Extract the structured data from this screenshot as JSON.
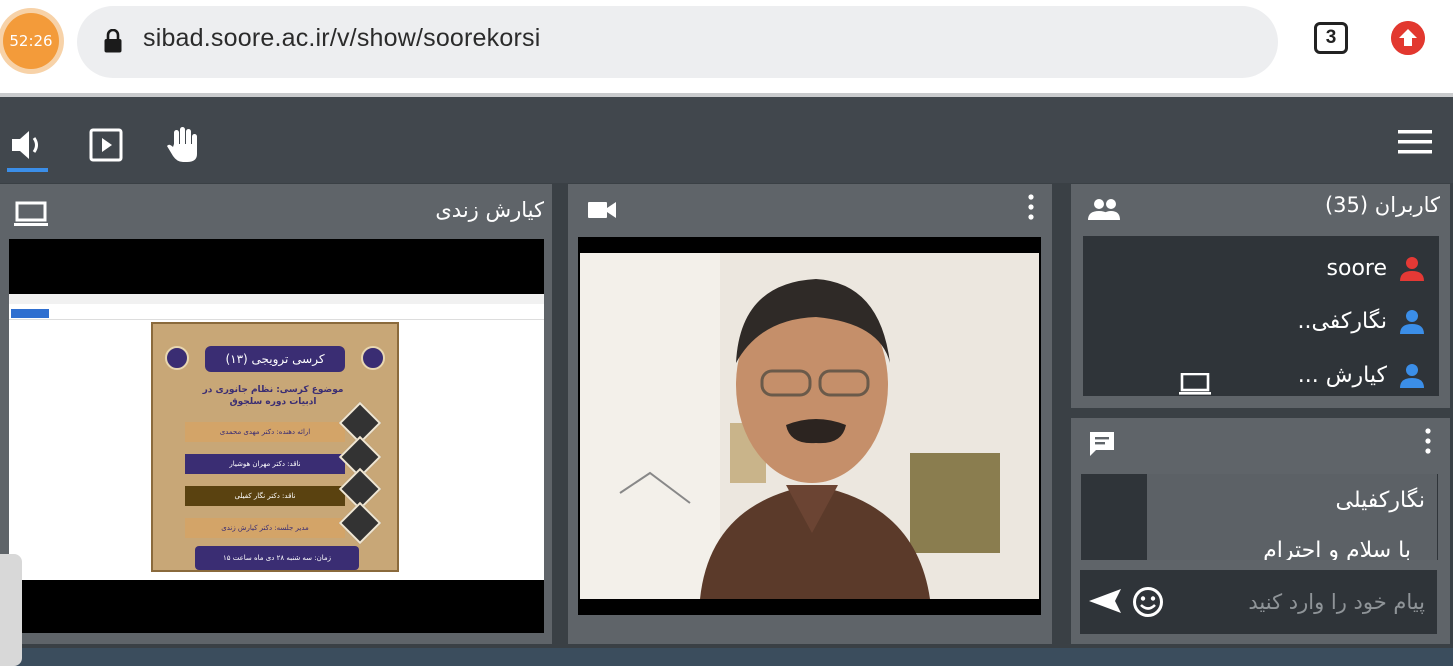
{
  "browser": {
    "timer": "52:26",
    "url": "sibad.soore.ac.ir/v/show/soorekorsi",
    "tab_count": "3"
  },
  "toolbar": {
    "icons": [
      "speaker-icon",
      "play-icon",
      "raise-hand-icon",
      "menu-icon"
    ],
    "accent": "#3b8ee8"
  },
  "presentation": {
    "title": "کیارش زندی",
    "poster": {
      "title": "کرسی ترویجی (۱۳)",
      "subject": "موضوع کرسی: نظام جانوری در ادبیات دوره سلجوق",
      "rows": [
        "ارائه دهنده: دکتر مهدی محمدی",
        "ناقد: دکتر مهران هوشیار",
        "ناقد: دکتر نگار کفیلی",
        "مدیر جلسه: دکتر کیارش زندی"
      ],
      "footer": "زمان: سه شنبه ۲۸ دی ماه ساعت ۱۵"
    }
  },
  "video": {
    "icon": "videocam-icon"
  },
  "users": {
    "title": "کاربران (35)",
    "items": [
      {
        "name": "soore",
        "color": "#e53935"
      },
      {
        "name": "نگارکفی..",
        "color": "#3b8ee8"
      },
      {
        "name": "کیارش ...",
        "color": "#3b8ee8"
      }
    ]
  },
  "chat": {
    "author": "نگارکفیلی",
    "message": "با سلام و احترام",
    "placeholder": "پیام خود را وارد کنید"
  }
}
